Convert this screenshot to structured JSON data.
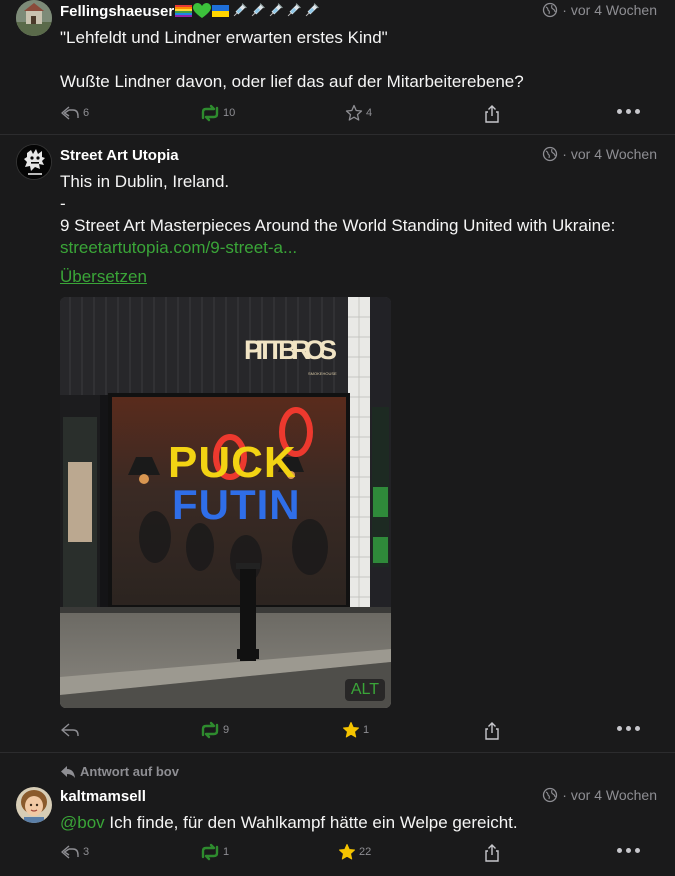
{
  "posts": [
    {
      "author": "Fellingshaeuser",
      "time": "vor 4 Wochen",
      "line1": "\"Lehfeldt und Lindner erwarten erstes Kind\"",
      "line2": "Wußte Lindner davon, oder lief das auf der Mitarbeiterebene?",
      "replies": "6",
      "boosts": "10",
      "favourites": "4"
    },
    {
      "author": "Street Art Utopia",
      "time": "vor 4 Wochen",
      "line1": "This in Dublin, Ireland.",
      "line2": "-",
      "line3": "9 Street Art Masterpieces Around the World Standing United with Ukraine:",
      "link": "streetartutopia.com/9-street-a...",
      "translate": "Übersetzen",
      "image": {
        "sign_top": "PITT BROS",
        "sign_small": "SMOKEHOUSE",
        "slogan_1": "PUCK",
        "slogan_2": "FUTIN",
        "alt_label": "ALT"
      },
      "boosts": "9",
      "favourites": "1"
    },
    {
      "reply_to": "Antwort auf bov",
      "author": "kaltmamsell",
      "time": "vor 4 Wochen",
      "mention": "@bov",
      "text": " Ich finde, für den Wahlkampf hätte ein Welpe gereicht.",
      "replies": "3",
      "boosts": "1",
      "favourites": "22"
    }
  ],
  "colors": {
    "background": "#1a1a1b",
    "link": "#3aa538",
    "star_active": "#f5c400",
    "boost": "#2e8b2e",
    "muted": "#8e8e93"
  }
}
